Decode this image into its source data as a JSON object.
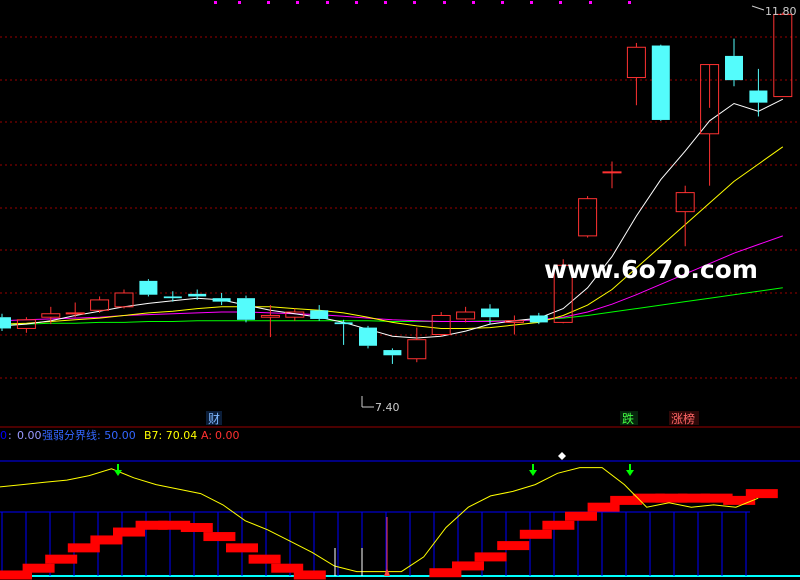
{
  "watermark": "www.6o7o.com",
  "labels": {
    "high_price": "11.80",
    "low_price": "7.40",
    "marker_cai": "财",
    "marker_die": "跌",
    "marker_zhangting": "涨榜"
  },
  "indicator": {
    "item1_label": "0",
    "item1_sep": " : ",
    "item1_value": "0.00",
    "item2": "强弱分界线: 50.00",
    "item3": "B7: 70.04",
    "item4_label": "A:",
    "item4_value": "0.00"
  },
  "colors": {
    "background": "#000000",
    "up_candle": "#ff3232",
    "down_candle": "#54fcfc",
    "ma5": "#ffffff",
    "ma10": "#ffff00",
    "ma20": "#ff00ff",
    "ma60": "#00ff00",
    "grid": "#990000",
    "panel_line": "#0000ff",
    "indicator_line": "#ffff00",
    "step_bar": "#ff0000",
    "arrow": "#00ff00"
  },
  "chart_data": {
    "type": "candlestick",
    "price_range": [
      7.3,
      11.9
    ],
    "candles": [
      {
        "o": 8.28,
        "h": 8.32,
        "l": 8.12,
        "c": 8.15
      },
      {
        "o": 8.15,
        "h": 8.28,
        "l": 8.1,
        "c": 8.25
      },
      {
        "o": 8.28,
        "h": 8.4,
        "l": 8.2,
        "c": 8.32
      },
      {
        "o": 8.32,
        "h": 8.45,
        "l": 8.28,
        "c": 8.33
      },
      {
        "o": 8.36,
        "h": 8.52,
        "l": 8.33,
        "c": 8.48
      },
      {
        "o": 8.4,
        "h": 8.6,
        "l": 8.38,
        "c": 8.56
      },
      {
        "o": 8.7,
        "h": 8.72,
        "l": 8.52,
        "c": 8.54
      },
      {
        "o": 8.52,
        "h": 8.58,
        "l": 8.46,
        "c": 8.5
      },
      {
        "o": 8.55,
        "h": 8.6,
        "l": 8.48,
        "c": 8.52
      },
      {
        "o": 8.5,
        "h": 8.56,
        "l": 8.42,
        "c": 8.46
      },
      {
        "o": 8.5,
        "h": 8.53,
        "l": 8.22,
        "c": 8.25
      },
      {
        "o": 8.28,
        "h": 8.42,
        "l": 8.05,
        "c": 8.3
      },
      {
        "o": 8.28,
        "h": 8.38,
        "l": 8.24,
        "c": 8.34
      },
      {
        "o": 8.36,
        "h": 8.42,
        "l": 8.24,
        "c": 8.26
      },
      {
        "o": 8.22,
        "h": 8.25,
        "l": 7.96,
        "c": 8.2
      },
      {
        "o": 8.16,
        "h": 8.18,
        "l": 7.92,
        "c": 7.95
      },
      {
        "o": 7.9,
        "h": 7.92,
        "l": 7.74,
        "c": 7.84
      },
      {
        "o": 7.8,
        "h": 8.16,
        "l": 7.76,
        "c": 8.02
      },
      {
        "o": 8.08,
        "h": 8.34,
        "l": 8.06,
        "c": 8.3
      },
      {
        "o": 8.26,
        "h": 8.4,
        "l": 8.22,
        "c": 8.34
      },
      {
        "o": 8.38,
        "h": 8.43,
        "l": 8.2,
        "c": 8.28
      },
      {
        "o": 8.22,
        "h": 8.3,
        "l": 8.08,
        "c": 8.24
      },
      {
        "o": 8.3,
        "h": 8.33,
        "l": 8.2,
        "c": 8.22
      },
      {
        "o": 8.22,
        "h": 8.95,
        "l": 8.21,
        "c": 8.88
      },
      {
        "o": 9.22,
        "h": 9.68,
        "l": 9.2,
        "c": 9.65
      },
      {
        "o": 9.95,
        "h": 10.08,
        "l": 9.77,
        "c": 9.96
      },
      {
        "o": 11.05,
        "h": 11.45,
        "l": 10.73,
        "c": 11.4
      },
      {
        "o": 11.42,
        "h": 11.43,
        "l": 10.55,
        "c": 10.56
      },
      {
        "o": 9.5,
        "h": 9.8,
        "l": 9.1,
        "c": 9.72
      },
      {
        "o": 10.4,
        "h": 10.7,
        "l": 9.8,
        "c": 11.2
      },
      {
        "o": 11.3,
        "h": 11.5,
        "l": 10.95,
        "c": 11.02
      },
      {
        "o": 10.9,
        "h": 11.15,
        "l": 10.6,
        "c": 10.76
      },
      {
        "o": 10.83,
        "h": 11.8,
        "l": 10.83,
        "c": 11.78
      }
    ],
    "ma5": [
      8.18,
      8.2,
      8.24,
      8.3,
      8.35,
      8.4,
      8.44,
      8.47,
      8.5,
      8.48,
      8.42,
      8.36,
      8.32,
      8.28,
      8.22,
      8.14,
      8.06,
      8.04,
      8.06,
      8.12,
      8.2,
      8.24,
      8.27,
      8.38,
      8.62,
      8.98,
      9.45,
      9.87,
      10.2,
      10.55,
      10.75,
      10.66,
      10.8
    ],
    "ma10": [
      8.2,
      8.21,
      8.23,
      8.25,
      8.27,
      8.3,
      8.33,
      8.35,
      8.38,
      8.4,
      8.4,
      8.4,
      8.38,
      8.36,
      8.33,
      8.28,
      8.22,
      8.18,
      8.15,
      8.15,
      8.16,
      8.19,
      8.22,
      8.3,
      8.42,
      8.6,
      8.85,
      9.1,
      9.35,
      9.6,
      9.85,
      10.05,
      10.25
    ],
    "ma20": [
      8.24,
      8.25,
      8.26,
      8.27,
      8.28,
      8.3,
      8.31,
      8.32,
      8.33,
      8.34,
      8.34,
      8.33,
      8.32,
      8.31,
      8.29,
      8.27,
      8.25,
      8.24,
      8.23,
      8.23,
      8.23,
      8.24,
      8.25,
      8.28,
      8.34,
      8.43,
      8.54,
      8.66,
      8.78,
      8.9,
      9.02,
      9.12,
      9.22
    ],
    "ma60": [
      8.2,
      8.2,
      8.21,
      8.21,
      8.22,
      8.22,
      8.23,
      8.23,
      8.24,
      8.24,
      8.24,
      8.24,
      8.24,
      8.24,
      8.24,
      8.24,
      8.23,
      8.23,
      8.23,
      8.23,
      8.24,
      8.24,
      8.25,
      8.27,
      8.3,
      8.34,
      8.38,
      8.42,
      8.46,
      8.5,
      8.54,
      8.58,
      8.62
    ],
    "indicator_line": [
      78,
      80,
      82,
      84,
      88,
      94,
      86,
      80,
      76,
      72,
      62,
      48,
      40,
      30,
      20,
      8,
      3,
      3,
      3,
      16,
      42,
      60,
      70,
      74,
      80,
      90,
      95,
      95,
      80,
      60,
      64,
      60,
      62,
      60,
      68
    ],
    "step_bars": [
      4,
      10,
      18,
      28,
      35,
      42,
      48,
      48,
      46,
      38,
      28,
      18,
      10,
      4,
      0,
      0,
      0,
      0,
      0,
      6,
      12,
      20,
      30,
      40,
      48,
      56,
      64,
      70,
      72,
      72,
      72,
      72,
      70,
      76
    ]
  }
}
